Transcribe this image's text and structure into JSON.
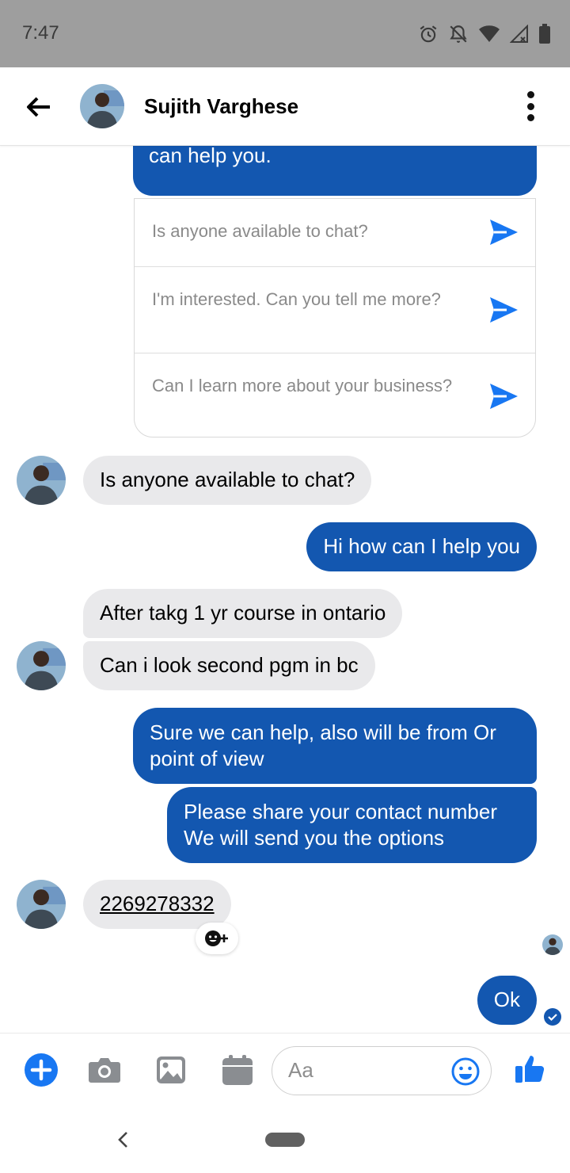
{
  "status_bar": {
    "time": "7:47"
  },
  "header": {
    "contact_name": "Sujith Varghese"
  },
  "greeting": {
    "text_partial": "Hi, Sujith! Please let us know how we can help you."
  },
  "quick_replies": [
    {
      "text": "Is anyone available to chat?"
    },
    {
      "text": "I'm interested. Can you tell me more?"
    },
    {
      "text": "Can I learn more about your business?"
    }
  ],
  "messages": {
    "m1": "Is anyone available to chat?",
    "m2": "Hi how can I help you",
    "m3": "After takg 1 yr course in ontario",
    "m4": "Can i look second pgm in bc",
    "m5": "Sure we can help, also will be from Or point of view",
    "m6": "Please share your contact number We will send you the options",
    "m7": "2269278332",
    "m8": "Ok"
  },
  "composer": {
    "placeholder": "Aa"
  },
  "colors": {
    "outgoing_bubble": "#1357b0",
    "incoming_bubble": "#e9e9eb",
    "accent": "#1877f2"
  },
  "icons": [
    "back-arrow-icon",
    "more-vert-icon",
    "send-icon",
    "reaction-add-icon",
    "plus-icon",
    "camera-icon",
    "image-icon",
    "calendar-icon",
    "emoji-icon",
    "thumbs-up-icon"
  ]
}
